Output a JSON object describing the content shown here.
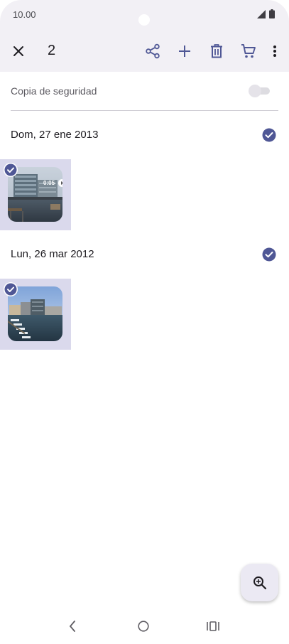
{
  "status_bar": {
    "time": "10.00"
  },
  "toolbar": {
    "selected_count": "2",
    "icons": [
      "close-icon",
      "share-icon",
      "add-icon",
      "delete-icon",
      "cart-icon",
      "more-vert-icon"
    ]
  },
  "backup": {
    "label": "Copia de seguridad",
    "enabled": false
  },
  "groups": [
    {
      "date": "Dom, 27 ene 2013",
      "selected": true,
      "items": [
        {
          "type": "video",
          "duration": "0:05",
          "selected": true
        }
      ]
    },
    {
      "date": "Lun, 26 mar 2012",
      "selected": true,
      "items": [
        {
          "type": "photo",
          "selected": true
        }
      ]
    }
  ],
  "fab": {
    "icon": "zoom-in-icon"
  },
  "colors": {
    "accent": "#4f5795",
    "selection_bg": "#dad9ec",
    "top_bar_bg": "#f2f0f5"
  }
}
